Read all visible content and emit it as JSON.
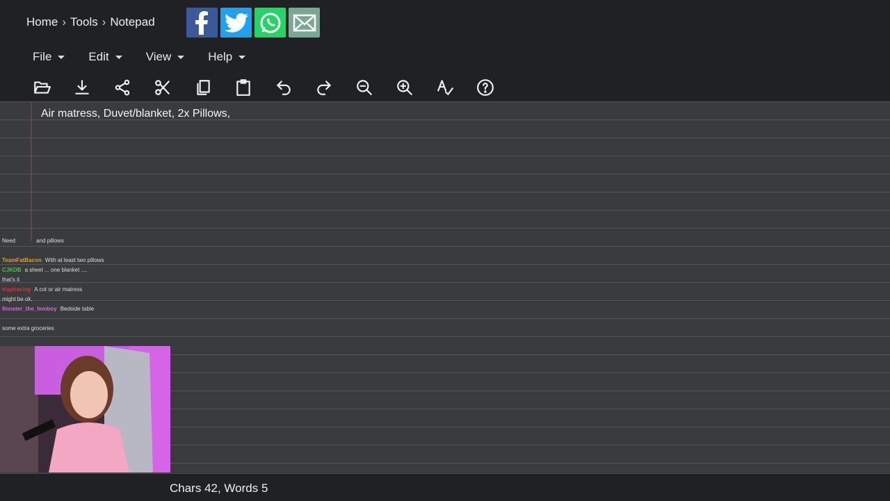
{
  "breadcrumb": {
    "home": "Home",
    "sep": "›",
    "tools": "Tools",
    "current": "Notepad"
  },
  "share": {
    "facebook_icon": "facebook-icon",
    "twitter_icon": "twitter-icon",
    "whatsapp_icon": "whatsapp-icon",
    "email_icon": "email-icon",
    "colors": {
      "facebook": "#3b5998",
      "twitter": "#1da1f2",
      "whatsapp": "#25d366",
      "email": "#7ba896"
    }
  },
  "menu": {
    "file": "File",
    "edit": "Edit",
    "view": "View",
    "help": "Help"
  },
  "toolbar": [
    "open-folder-icon",
    "download-icon",
    "share-icon",
    "cut-icon",
    "copy-icon",
    "paste-icon",
    "undo-icon",
    "redo-icon",
    "zoom-out-icon",
    "zoom-in-icon",
    "spellcheck-icon",
    "help-icon"
  ],
  "editor": {
    "text": "Air matress, Duvet/blanket, 2x Pillows,"
  },
  "chat": {
    "lines": [
      {
        "user": "",
        "msg": "Need",
        "msg2": "and pillows",
        "color": "#c33"
      },
      {
        "user": "",
        "msg": "",
        "color": "#3a3"
      },
      {
        "user": "TeamFatBacon",
        "msg": "With at least two pillows",
        "color": "#d8a32a"
      },
      {
        "user": "CJKDB",
        "msg": "a sheet ... one blanket ....",
        "color": "#41c741"
      },
      {
        "user": "",
        "msg": "that's it",
        "color": "#ddd"
      },
      {
        "user": "traytracing",
        "msg": "A cot or air matress",
        "color": "#d33"
      },
      {
        "user": "",
        "msg": "might be ok.",
        "color": "#ddd"
      },
      {
        "user": "finnster_the_femboy",
        "msg": "Bedside table",
        "color": "#d36ad6"
      },
      {
        "user": "",
        "msg": "",
        "color": "#3a3"
      },
      {
        "user": "",
        "msg": "some extra groceries",
        "color": "#3a3"
      }
    ]
  },
  "status": {
    "text": "Chars 42, Words 5"
  }
}
